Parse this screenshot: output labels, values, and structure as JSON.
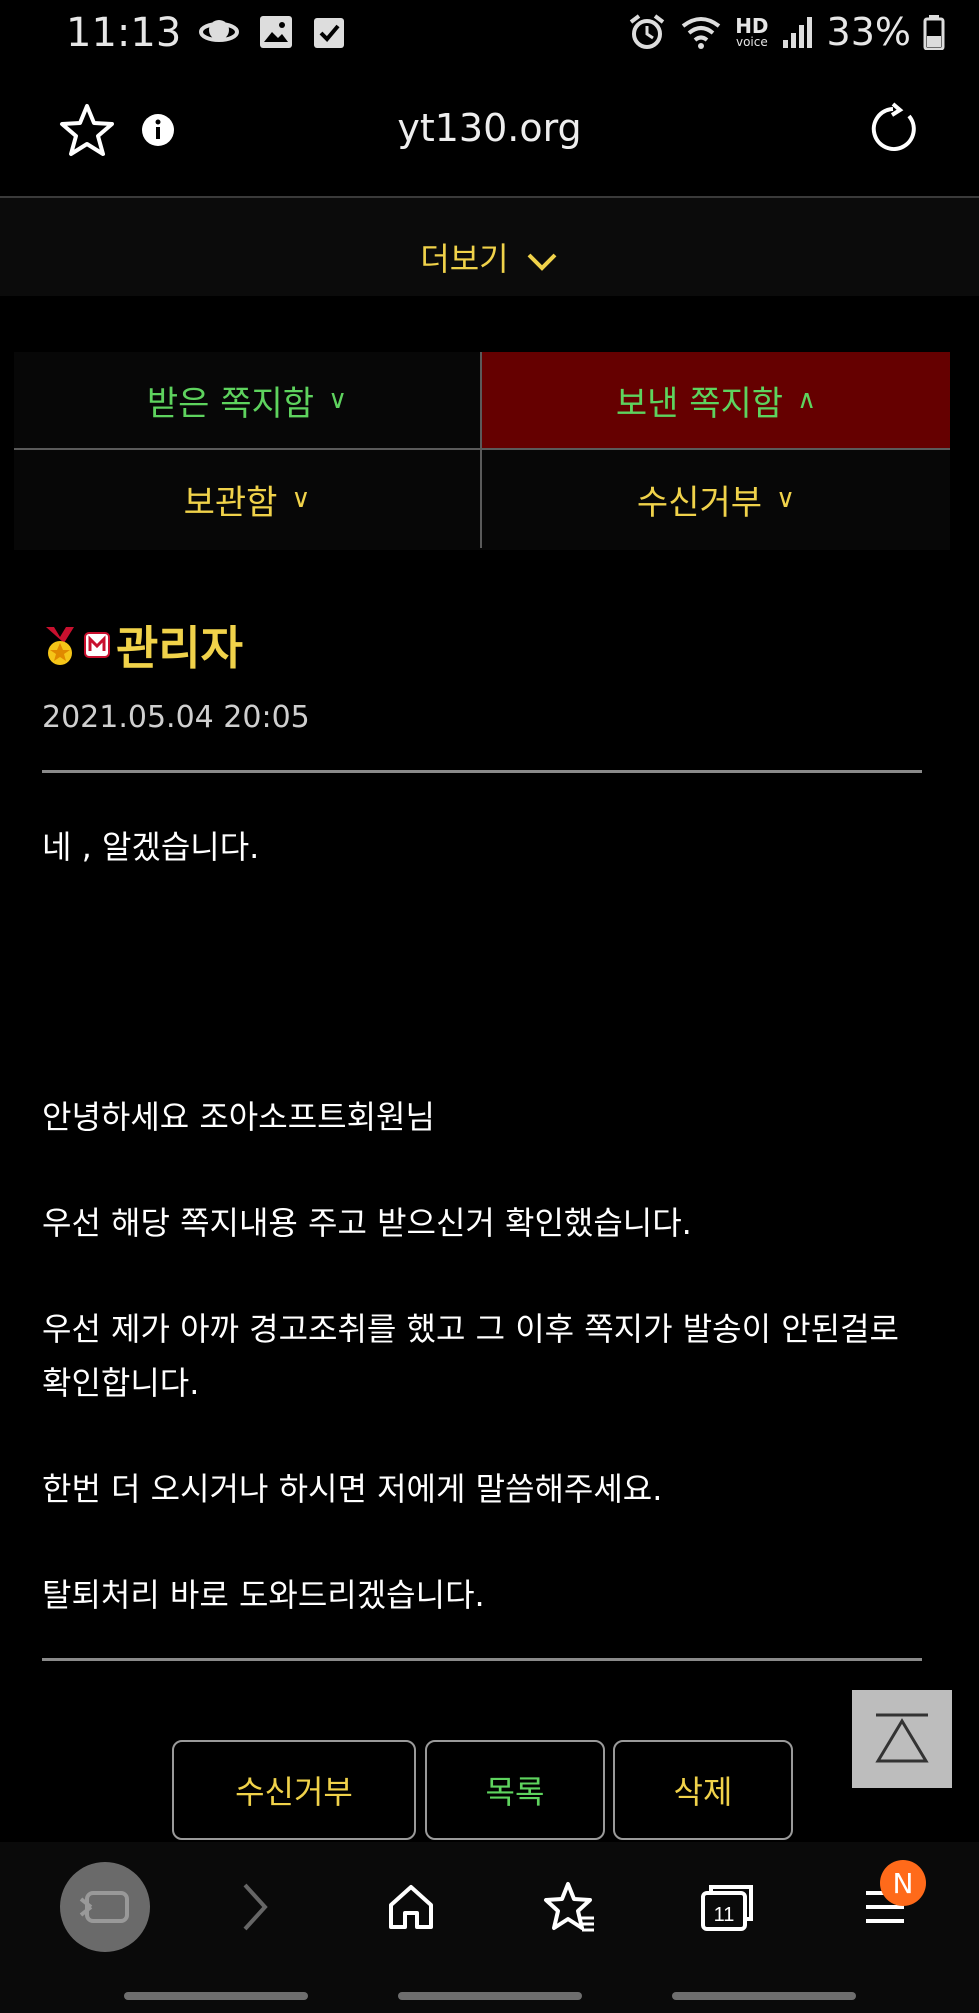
{
  "status_bar": {
    "time": "11:13",
    "hd_label": "HD",
    "voice_label": "voice",
    "battery": "33%"
  },
  "browser": {
    "url": "yt130.org"
  },
  "more_label": "더보기",
  "tabs": [
    {
      "label": "받은 쪽지함",
      "active": false
    },
    {
      "label": "보낸 쪽지함",
      "active": true
    },
    {
      "label": "보관함",
      "active": false
    },
    {
      "label": "수신거부",
      "active": false
    }
  ],
  "message": {
    "author": "관리자",
    "date": "2021.05.04 20:05",
    "lines": [
      "네 , 알겠습니다.",
      "안녕하세요 조아소프트회원님",
      "우선 해당 쪽지내용 주고 받으신거 확인했습니다.",
      "우선 제가 아까 경고조취를 했고 그 이후 쪽지가 발송이 안된걸로 확인합니다.",
      "한번 더 오시거나 하시면 저에게 말씀해주세요.",
      "탈퇴처리 바로 도와드리겠습니다."
    ]
  },
  "actions": {
    "block": "수신거부",
    "list": "목록",
    "delete": "삭제"
  },
  "bottom_nav": {
    "tab_count": "11",
    "menu_badge": "N"
  },
  "colors": {
    "accent_yellow": "#f0d24a",
    "accent_green": "#5ed35e",
    "active_tab_bg": "#650000"
  }
}
